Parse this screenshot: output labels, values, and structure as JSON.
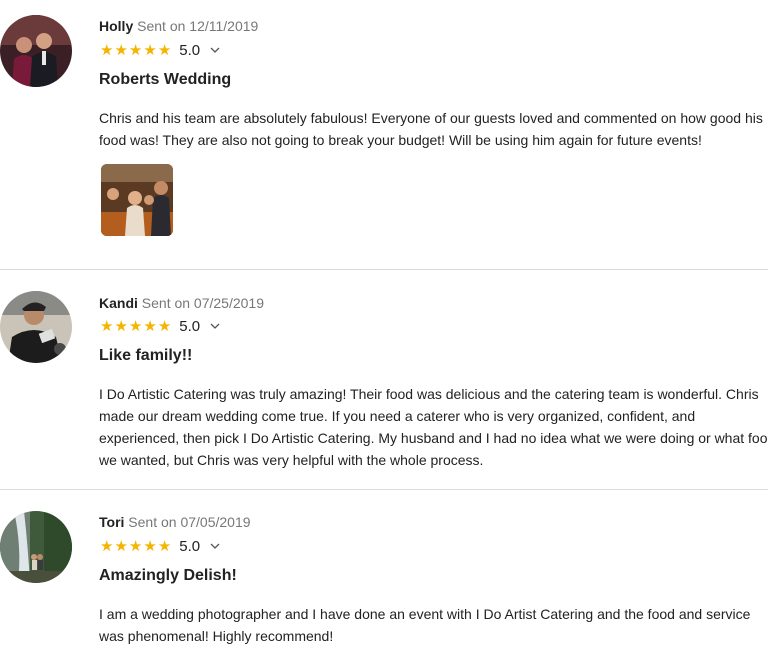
{
  "reviews": [
    {
      "name": "Holly",
      "sent": "Sent on 12/11/2019",
      "score": "5.0",
      "title": "Roberts Wedding",
      "lines": [
        "Chris and his team are absolutely fabulous! Everyone of our guests loved and commented on how good his",
        "food was! They are also not going to break your budget! Will be using him again for future events!"
      ],
      "rating_value": 5,
      "has_photo": true
    },
    {
      "name": "Kandi",
      "sent": "Sent on 07/25/2019",
      "score": "5.0",
      "title": "Like family!!",
      "lines": [
        "I Do Artistic Catering was truly amazing! Their food was delicious and the catering team is wonderful. Chris",
        "made our dream wedding come true. If you need a caterer who is very organized, confident, and",
        "experienced, then pick I Do Artistic Catering. My husband and I had no idea what we were doing or what food",
        "we wanted, but Chris was very helpful with the whole process."
      ],
      "rating_value": 5,
      "has_photo": false
    },
    {
      "name": "Tori",
      "sent": "Sent on 07/05/2019",
      "score": "5.0",
      "title": "Amazingly Delish!",
      "lines": [
        "I am a wedding photographer and I have done an event with I Do Artist Catering and the food and service",
        "was phenomenal! Highly recommend!"
      ],
      "rating_value": 5,
      "has_photo": false
    }
  ],
  "colors": {
    "star": "#f5b400",
    "divider": "#dcdcdc",
    "meta": "#777777"
  },
  "icons": {
    "star": "star-icon",
    "chevron": "chevron-down-icon"
  }
}
